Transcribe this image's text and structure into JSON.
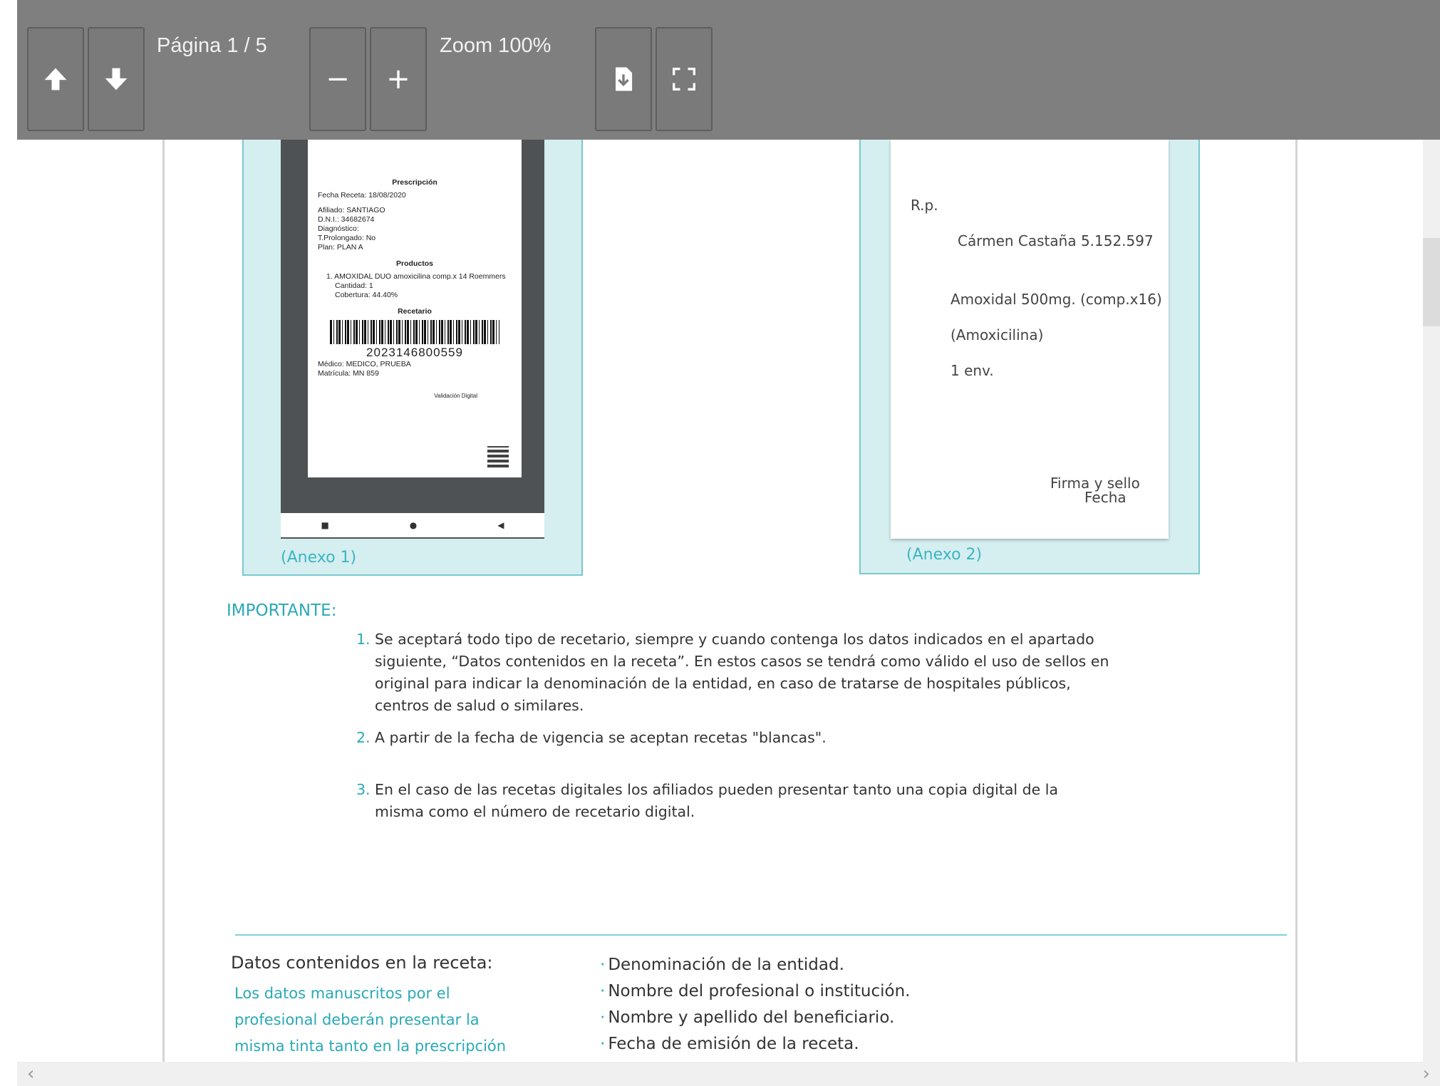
{
  "toolbar": {
    "page_label": "Página 1 / 5",
    "zoom_label": "Zoom 100%",
    "prev_page_icon": "arrow-up-icon",
    "next_page_icon": "arrow-down-icon",
    "zoom_out_label": "−",
    "zoom_in_label": "+",
    "download_icon": "download-file-icon",
    "fullscreen_icon": "fullscreen-icon"
  },
  "annex1": {
    "label": "(Anexo 1)",
    "receipt": {
      "section_prescripcion": "Prescripción",
      "fecha_receta": "Fecha Receta: 18/08/2020",
      "afiliado": "Afiliado: SANTIAGO",
      "dni": "D.N.I.: 34682674",
      "diagnostico": "Diagnóstico:",
      "tprolongado": "T.Prolongado: No",
      "plan": "Plan: PLAN A",
      "section_productos": "Productos",
      "producto_1": "1. AMOXIDAL DUO amoxicilina comp.x 14 Roemmers",
      "cantidad": "Cantidad: 1",
      "cobertura": "Cobertura: 44.40%",
      "section_recetario": "Recetario",
      "barcode_number": "2023146800559",
      "medico": "Médico: MEDICO, PRUEBA",
      "matricula": "Matrícula: MN 859",
      "validacion": "Validación Digital"
    }
  },
  "annex2": {
    "label": "(Anexo 2)",
    "rp": "R.p.",
    "patient": "Cármen Castaña  5.152.597",
    "drug": "Amoxidal 500mg. (comp.x16)",
    "generic": "(Amoxicilina)",
    "qty": "1 env.",
    "firma": "Firma y sello",
    "fecha": "Fecha"
  },
  "important": {
    "title": "IMPORTANTE:",
    "items": [
      {
        "num": "1.",
        "text": "Se aceptará todo tipo de recetario, siempre y cuando contenga los datos indicados en el apartado siguiente, “Datos contenidos en la receta”. En estos casos se tendrá como válido el uso de sellos en original para indicar la denominación de la entidad, en caso de tratarse de hospitales públicos, centros de salud o similares."
      },
      {
        "num": "2.",
        "text": "A partir de la fecha de vigencia se aceptan recetas \"blancas\"."
      },
      {
        "num": "3.",
        "text": "En el caso de las recetas digitales los afiliados pueden presentar tanto una copia digital de la misma como el número de recetario digital."
      }
    ]
  },
  "datos": {
    "title": "Datos contenidos en la receta:",
    "note": "Los datos manuscritos por el profesional deberán presentar la misma tinta tanto en la prescripción",
    "items": [
      "Denominación de la entidad.",
      "Nombre del profesional o institución.",
      "Nombre y apellido del beneficiario.",
      "Fecha de emisión de la receta."
    ]
  },
  "colors": {
    "toolbar_bg": "#7f7f7f",
    "accent_teal": "#2aa9b6",
    "annex_bg": "#d5eef0"
  }
}
